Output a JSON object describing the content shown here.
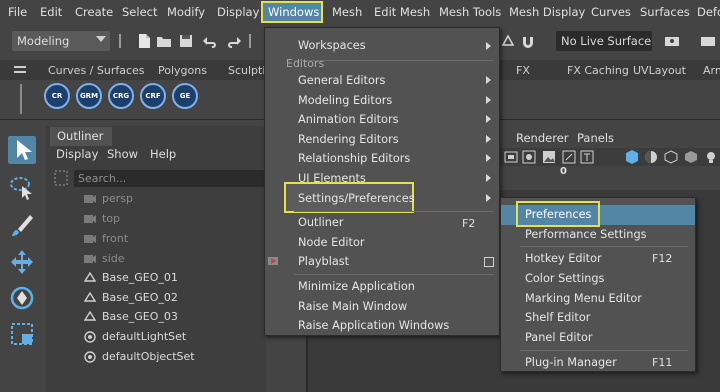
{
  "menubar": {
    "items": [
      "File",
      "Edit",
      "Create",
      "Select",
      "Modify",
      "Display",
      "Windows",
      "Mesh",
      "Edit Mesh",
      "Mesh Tools",
      "Mesh Display",
      "Curves",
      "Surfaces",
      "Defo"
    ]
  },
  "statusline": {
    "mode": "Modeling",
    "live_surface": "No Live Surface"
  },
  "shelf": {
    "tabs": [
      "Curves / Surfaces",
      "Polygons",
      "Sculptin",
      "FX",
      "FX Caching",
      "UVLayout",
      "Arn"
    ],
    "buttons": [
      "CR",
      "GRM",
      "CRG",
      "CRF",
      "GE"
    ]
  },
  "outliner": {
    "title": "Outliner",
    "menus": [
      "Display",
      "Show",
      "Help"
    ],
    "search_placeholder": "Search...",
    "rows": [
      {
        "label": "persp",
        "dim": true
      },
      {
        "label": "top",
        "dim": true
      },
      {
        "label": "front",
        "dim": true
      },
      {
        "label": "side",
        "dim": true
      },
      {
        "label": "Base_GEO_01",
        "dim": false
      },
      {
        "label": "Base_GEO_02",
        "dim": false
      },
      {
        "label": "Base_GEO_03",
        "dim": false
      },
      {
        "label": "defaultLightSet",
        "dim": false
      },
      {
        "label": "defaultObjectSet",
        "dim": false
      }
    ]
  },
  "viewport": {
    "menus": [
      "Renderer",
      "Panels"
    ],
    "counter": "0"
  },
  "windows_menu": {
    "section_label": "Editors",
    "items": [
      {
        "label": "Workspaces",
        "submenu": true
      },
      {
        "label": "General Editors",
        "submenu": true
      },
      {
        "label": "Modeling Editors",
        "submenu": true
      },
      {
        "label": "Animation Editors",
        "submenu": true
      },
      {
        "label": "Rendering Editors",
        "submenu": true
      },
      {
        "label": "Relationship Editors",
        "submenu": true
      },
      {
        "label": "UI Elements",
        "submenu": true
      },
      {
        "label": "Settings/Preferences",
        "submenu": true
      },
      {
        "label": "Outliner",
        "shortcut": "F2"
      },
      {
        "label": "Node Editor"
      },
      {
        "label": "Playblast",
        "option_box": true
      },
      {
        "label": "Minimize Application"
      },
      {
        "label": "Raise Main Window"
      },
      {
        "label": "Raise Application Windows"
      }
    ]
  },
  "settings_submenu": {
    "items": [
      {
        "label": "Preferences"
      },
      {
        "label": "Performance Settings"
      },
      {
        "label": "Hotkey Editor",
        "shortcut": "F12"
      },
      {
        "label": "Color Settings"
      },
      {
        "label": "Marking Menu Editor"
      },
      {
        "label": "Shelf Editor"
      },
      {
        "label": "Panel Editor"
      },
      {
        "label": "Plug-in Manager",
        "shortcut": "F11"
      }
    ]
  },
  "colors": {
    "highlight_box": "#e8e04a",
    "selection_blue": "#5285a6",
    "menu_bg": "#525252",
    "shelf_button": "#1c3f6e"
  }
}
